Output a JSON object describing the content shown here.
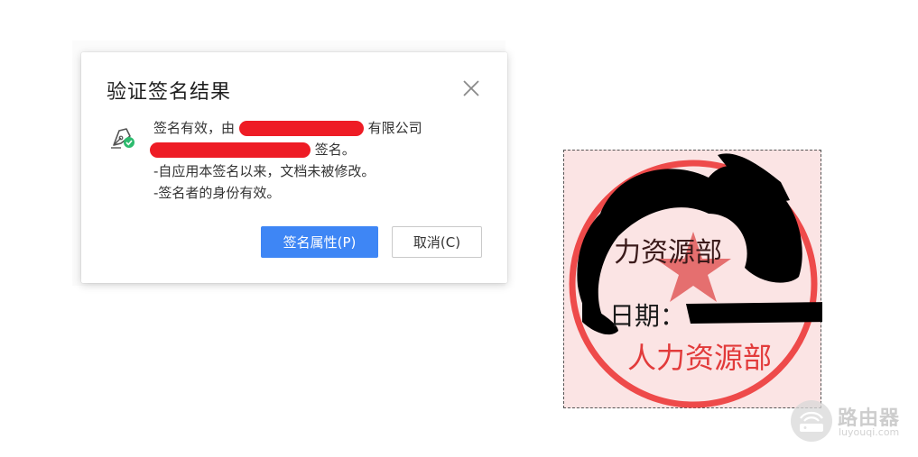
{
  "dialog": {
    "title": "验证签名结果",
    "message": {
      "line1_prefix": "签名有效，由",
      "line1_suffix": "有限公司",
      "line2_suffix": "签名。",
      "line3": "-自应用本签名以来，文档未被修改。",
      "line4": "-签名者的身份有效。"
    },
    "buttons": {
      "properties": "签名属性(P)",
      "cancel": "取消(C)"
    }
  },
  "stamp": {
    "top_text": "力资源部",
    "date_label": "日期：",
    "bottom_text": "人力资源部"
  },
  "watermark": {
    "name": "路由器",
    "url": "luyouqi.com"
  },
  "colors": {
    "primary_button": "#3e86f5",
    "stamp_red": "#e23b3b",
    "stamp_background": "#fbe4e4",
    "redaction": "#ee1c25"
  }
}
